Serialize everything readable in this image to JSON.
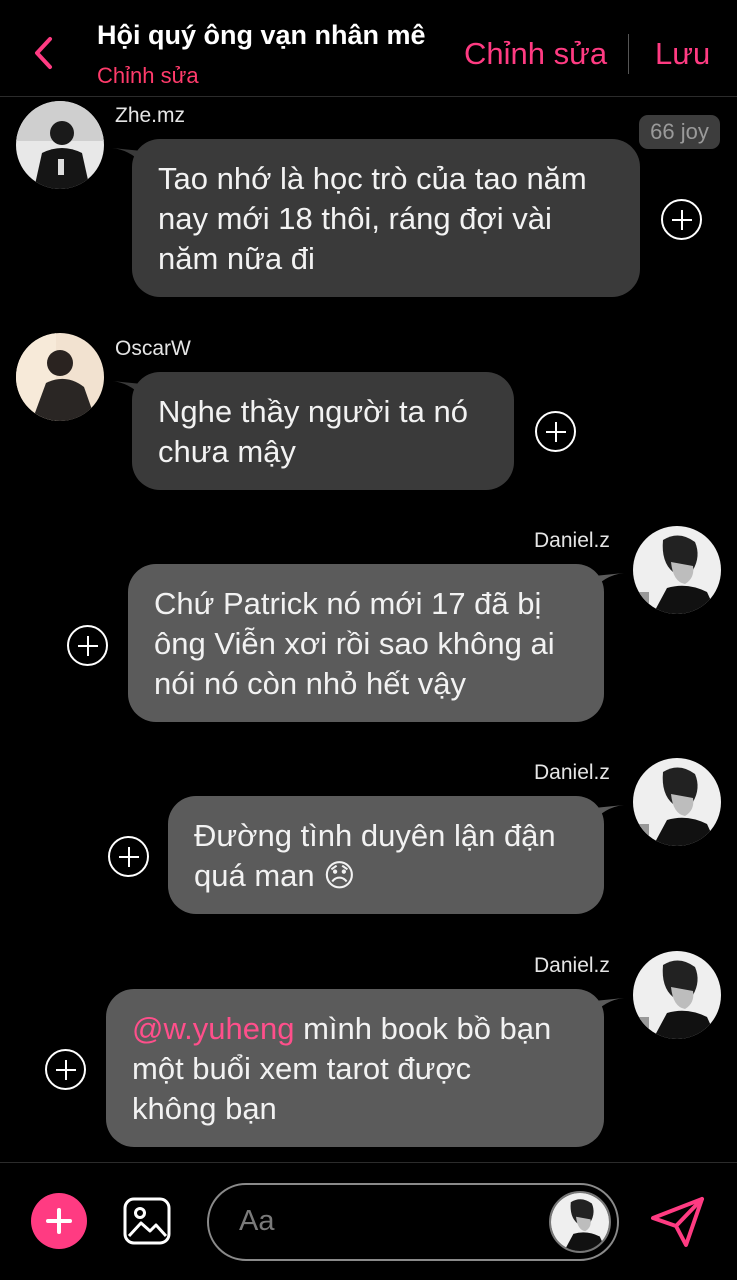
{
  "header": {
    "title": "Hội quý ông vạn nhân mê",
    "subtitle": "Chỉnh sửa",
    "edit_label": "Chỉnh sửa",
    "save_label": "Lưu",
    "accent": "#ff3b82"
  },
  "badge": {
    "text": "66 joy"
  },
  "messages": [
    {
      "sender": "Zhe.mz",
      "side": "left",
      "lines": [
        "Tao nhớ là học trò của tao năm",
        "nay mới 18 thôi, ráng đợi vài",
        "năm nữa đi"
      ]
    },
    {
      "sender": "OscarW",
      "side": "left",
      "lines": [
        "Nghe thầy người ta nó",
        "chưa mậy"
      ]
    },
    {
      "sender": "Daniel.z",
      "side": "right",
      "lines": [
        "Chứ Patrick nó mới 17 đã bị",
        "ông Viễn xơi rồi sao không ai",
        "nói nó còn nhỏ hết vậy"
      ]
    },
    {
      "sender": "Daniel.z",
      "side": "right",
      "lines": [
        "Đường tình duyên lận đận",
        "quá man"
      ],
      "emoji": "😞"
    },
    {
      "sender": "Daniel.z",
      "side": "right",
      "mention": "@w.yuheng",
      "lines": [
        " mình book bồ bạn",
        "một buổi xem tarot được",
        "không bạn"
      ]
    }
  ],
  "composer": {
    "placeholder": "Aa"
  },
  "icons": {
    "back": "chevron-left-icon",
    "react": "plus-circle-icon",
    "add": "plus-icon",
    "gallery": "image-icon",
    "send": "send-icon"
  }
}
